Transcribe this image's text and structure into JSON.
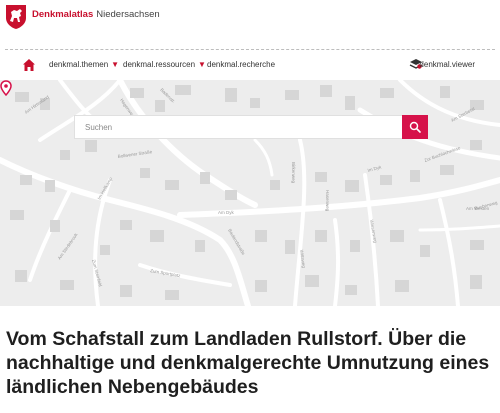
{
  "brand": {
    "name_red": "Denkmalatlas",
    "name_gray": "Niedersachsen"
  },
  "nav": {
    "items": [
      {
        "label": "denkmal.themen",
        "has_menu": true
      },
      {
        "label": "denkmal.ressourcen",
        "has_menu": true
      },
      {
        "label": "denkmal.recherche",
        "has_menu": false
      }
    ],
    "caret": "▼",
    "viewer_label": "denkmal.viewer"
  },
  "map": {
    "street_labels": [
      "Bollwener Straße",
      "Badenstr.",
      "Im Dyk",
      "Baulandstraße",
      "Am Dyk",
      "Birkenweg",
      "Hasenweg",
      "Zur Buchlochwiese",
      "Am Sterbetal",
      "Wiesenweg",
      "Wittsweg",
      "Am Hirtenland",
      "Buchenweg",
      "Hagenweg",
      "Im Hellkamp",
      "Zum Steinfeld",
      "Zum Sportplatz",
      "Am Stedebrook",
      "Am Westen"
    ],
    "marker_icon": "location-pin-icon"
  },
  "search": {
    "placeholder": "Suchen",
    "value": ""
  },
  "article": {
    "title": "Vom Schafstall zum Landladen Rullstorf. Über die nachhaltige und denkmalgerechte Umnutzung eines ländlichen Nebengebäudes"
  },
  "colors": {
    "accent": "#d6124a",
    "brand_red": "#c8102e",
    "map_bg": "#ededed",
    "building": "#d6d6d6"
  }
}
